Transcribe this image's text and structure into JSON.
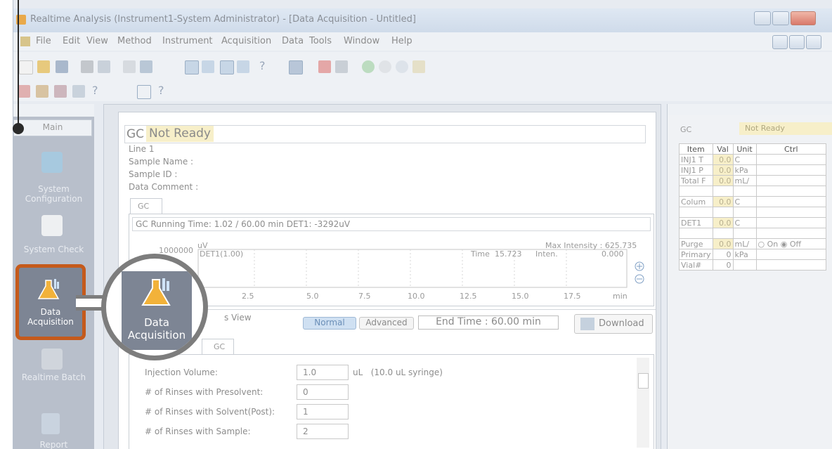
{
  "window": {
    "title": "Realtime Analysis (Instrument1-System Administrator) - [Data Acquisition - Untitled]"
  },
  "menu": [
    "File",
    "Edit",
    "View",
    "Method",
    "Instrument",
    "Acquisition",
    "Data",
    "Tools",
    "Window",
    "Help"
  ],
  "sidebar": {
    "header": "Main",
    "items": [
      {
        "label_line1": "System",
        "label_line2": "Configuration",
        "icon": "system-configuration-icon"
      },
      {
        "label_line1": "System Check",
        "label_line2": "",
        "icon": "system-check-icon"
      },
      {
        "label_line1": "Data",
        "label_line2": "Acquisition",
        "icon": "data-acquisition-icon"
      },
      {
        "label_line1": "Realtime Batch",
        "label_line2": "",
        "icon": "realtime-batch-icon"
      },
      {
        "label_line1": "Report",
        "label_line2": "",
        "icon": "report-icon"
      }
    ]
  },
  "status": {
    "prefix": "GC",
    "state": "Not Ready"
  },
  "info": {
    "line": "Line 1",
    "sample_name": "Sample Name :",
    "sample_id": "Sample ID :",
    "data_comment": "Data Comment :"
  },
  "chart_tab": "GC",
  "running_text": "GC Running Time: 1.02 / 60.00 min DET1: -3292uV",
  "chart_data": {
    "type": "line",
    "y_unit": "uV",
    "y_top_label": "1000000",
    "series": [
      {
        "name": "DET1(1.00)",
        "values": []
      }
    ],
    "x_ticks": [
      "2.5",
      "5.0",
      "7.5",
      "10.0",
      "12.5",
      "15.0",
      "17.5",
      "min"
    ],
    "max_intensity": "Max Intensity : 625.735",
    "time_label": "Time",
    "time_value": "15.723",
    "inten_label": "Inten.",
    "inten_value": "0.000"
  },
  "method": {
    "view_label": "s View",
    "mode_normal": "Normal",
    "mode_advanced": "Advanced",
    "end_time": "End Time : 60.00 min",
    "download": "Download",
    "tab": "GC",
    "params": [
      {
        "label": "Injection Volume:",
        "value": "1.0",
        "suffix": "uL   (10.0 uL syringe)"
      },
      {
        "label": "# of Rinses with Presolvent:",
        "value": "0",
        "suffix": ""
      },
      {
        "label": "# of Rinses with Solvent(Post):",
        "value": "1",
        "suffix": ""
      },
      {
        "label": "# of Rinses with Sample:",
        "value": "2",
        "suffix": ""
      }
    ]
  },
  "monitor": {
    "gc_label": "GC",
    "status": "Not Ready",
    "headers": [
      "Item",
      "Val",
      "Unit",
      "Ctrl"
    ],
    "rows": [
      {
        "item": "INJ1 T",
        "val": "0.0",
        "unit": "C"
      },
      {
        "item": "INJ1 P",
        "val": "0.0",
        "unit": "kPa"
      },
      {
        "item": "Total F",
        "val": "0.0",
        "unit": "mL/"
      },
      {
        "item": "",
        "val": "",
        "unit": ""
      },
      {
        "item": "Colum",
        "val": "0.0",
        "unit": "C"
      },
      {
        "item": "",
        "val": "",
        "unit": ""
      },
      {
        "item": "DET1",
        "val": "0.0",
        "unit": "C"
      },
      {
        "item": "",
        "val": "",
        "unit": ""
      },
      {
        "item": "Purge",
        "val": "0.0",
        "unit": "mL/"
      },
      {
        "item": "Primary",
        "val": "0",
        "unit": "kPa"
      },
      {
        "item": "Vial#",
        "val": "0",
        "unit": ""
      }
    ],
    "purge_on": "On",
    "purge_off": "Off"
  },
  "magnifier": {
    "label_line1": "Data",
    "label_line2": "Acquisition"
  },
  "colors": {
    "highlight": "#c55a1b",
    "status_bg": "#f7efc9",
    "sidebar": "#b8bfcb"
  }
}
